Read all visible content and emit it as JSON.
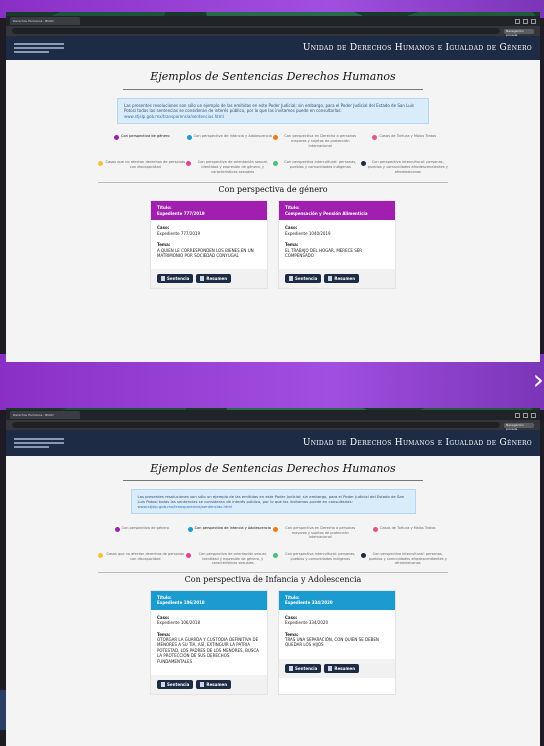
{
  "browser": {
    "tab_title": "Derechos Humanos - BOLD",
    "profile_label": "Navegación privada"
  },
  "header": {
    "site_title": "Unidad de Derechos Humanos e Igualdad de Género"
  },
  "page": {
    "title": "Ejemplos de Sentencias Derechos Humanos",
    "info_text": "Las presentes resoluciones son sólo un ejemplo de las emitidas en este Poder Judicial; sin embargo, para el Poder Judicial del Estado de San Luis Potosí todas las sentencias se consideran de interés público, por lo que las invitamos puede en consultarlas:",
    "info_link": "www.stjslp.gob.mx/transparencia/sentencias.html"
  },
  "filters": [
    {
      "label": "Con perspectiva de género",
      "color": "#a01fae"
    },
    {
      "label": "Con perspectiva de Infancia y Adolescencia",
      "color": "#1b9bd0"
    },
    {
      "label": "Con perspectiva en Derecho a personas mayores y sujetos de protección internacional",
      "color": "#f07b1a"
    },
    {
      "label": "Casos de Tortura y Malos Tratos",
      "color": "#e4577b"
    },
    {
      "label": "Casos que no afectan derechos de personas con discapacidad",
      "color": "#f6c23e"
    },
    {
      "label": "Con perspectiva de orientación sexual, identidad y expresión de género, y características sexuales",
      "color": "#e43f9c"
    },
    {
      "label": "Con perspectiva intercultural: personas, pueblos y comunidades indígenas",
      "color": "#48c17a"
    },
    {
      "label": "Con perspectiva intercultural: personas, pueblos y comunidades afrodescendientes y afromexicanas",
      "color": "#1d2b44"
    }
  ],
  "view1": {
    "section_title": "Con perspectiva de género",
    "active_filter": 0,
    "header_color": "#a01fae",
    "cards": [
      {
        "title_label": "Título:",
        "title": "Expediente 777/2019",
        "case_label": "Caso:",
        "case": "Expediente 777/2019",
        "topic_label": "Tema:",
        "topic": "A QUIEN LE CORRESPONDEN LOS BIENES EN UN MATRIMONIO POR SOCIEDAD CONYUGAL",
        "btn1": "Sentencia",
        "btn2": "Resumen"
      },
      {
        "title_label": "Título:",
        "title": "Compensación y Pensión Alimenticia",
        "case_label": "Caso:",
        "case": "Expediente 1040/2019",
        "topic_label": "Tema:",
        "topic": "EL TRABAJO DEL HOGAR, MERECE SER COMPENSADO",
        "btn1": "Sentencia",
        "btn2": "Resumen"
      }
    ]
  },
  "view2": {
    "section_title": "Con perspectiva de Infancia y Adolescencia",
    "active_filter": 1,
    "header_color": "#1b9bd0",
    "cards": [
      {
        "title_label": "Título:",
        "title": "Expediente 106/2018",
        "case_label": "Caso:",
        "case": "Expediente 106/2018",
        "topic_label": "Tema:",
        "topic": "OTORGAR LA GUARDA Y CUSTODIA DEFINITIVA DE MENORES A SU TÍA, ASÍ, EXTINGUIR LA PATRIA POTESTAD, LOS PADRES DE LOS MENORES, BUSCA LA PROTECCIÓN DE SUS DERECHOS FUNDAMENTALES",
        "btn1": "Sentencia",
        "btn2": "Resumen"
      },
      {
        "title_label": "Título:",
        "title": "Expediente 334/2020",
        "case_label": "Caso:",
        "case": "Expediente 334/2020",
        "topic_label": "Tema:",
        "topic": "TRAS UNA SEPARACIÓN, CON QUIEN SE DEBEN QUEDAR LOS HIJOS",
        "btn1": "Sentencia",
        "btn2": "Resumen"
      }
    ]
  }
}
